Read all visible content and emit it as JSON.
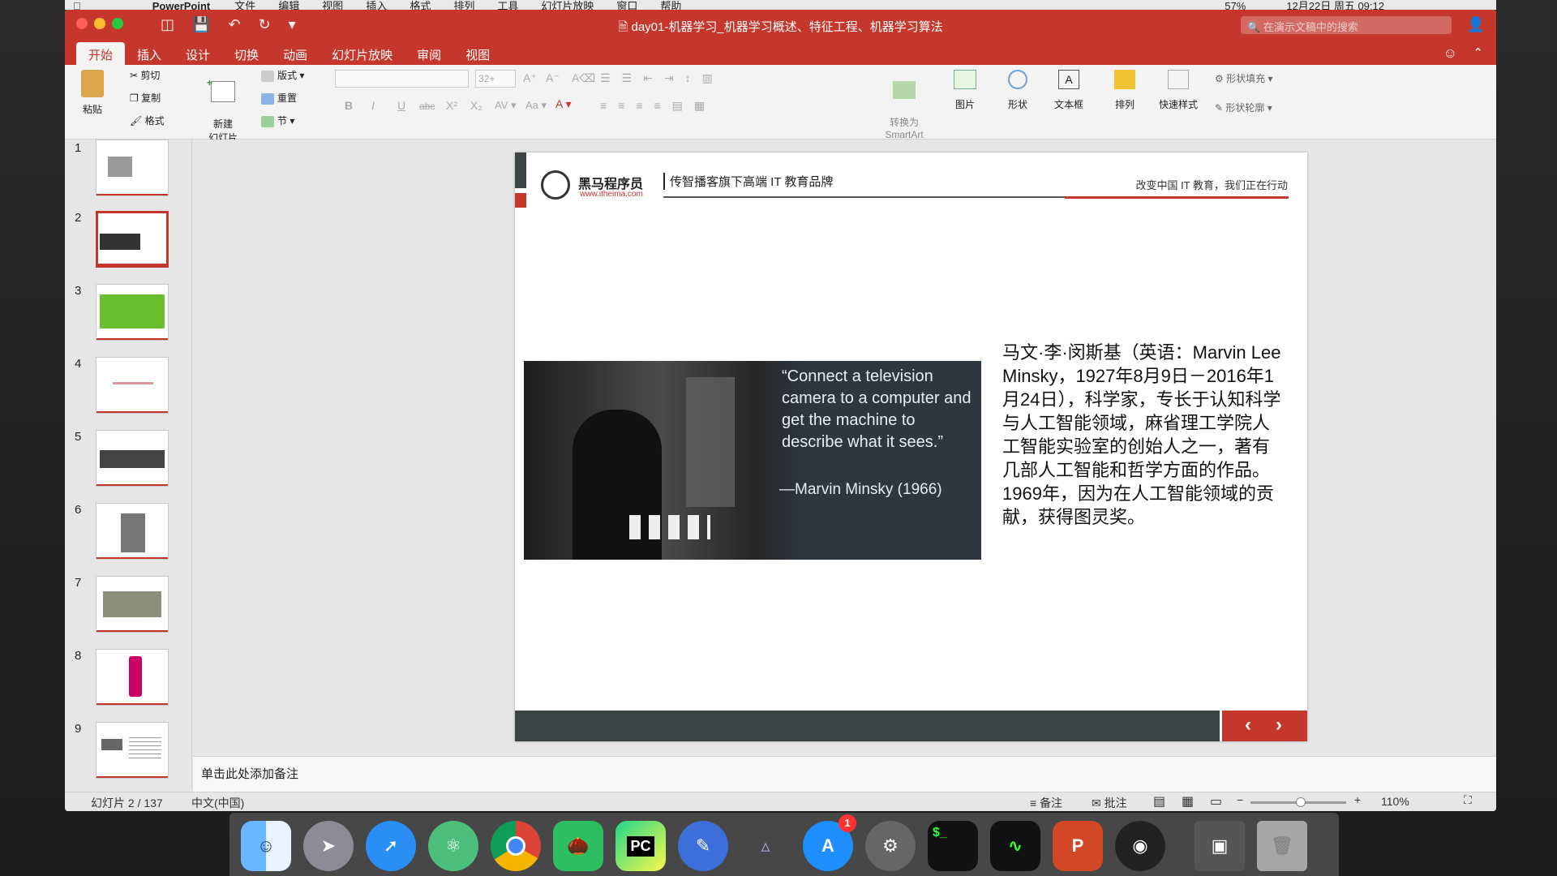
{
  "menubar": {
    "app": "PowerPoint",
    "items": [
      "文件",
      "编辑",
      "视图",
      "插入",
      "格式",
      "排列",
      "工具",
      "幻灯片放映",
      "窗口",
      "帮助"
    ],
    "battery": "57%",
    "datetime": "12月22日 周五 09:12"
  },
  "window": {
    "title": "day01-机器学习_机器学习概述、特征工程、机器学习算法",
    "search_placeholder": "在演示文稿中的搜索"
  },
  "tabs": [
    "开始",
    "插入",
    "设计",
    "切换",
    "动画",
    "幻灯片放映",
    "审阅",
    "视图"
  ],
  "ribbon": {
    "paste": "粘贴",
    "cut": "剪切",
    "copy": "复制",
    "format": "格式",
    "new_slide": "新建\n幻灯片",
    "layout": "版式",
    "reset": "重置",
    "section": "节",
    "font_size": "32+",
    "convert_smartart": "转换为\nSmartArt",
    "picture": "图片",
    "shape": "形状",
    "textbox": "文本框",
    "arrange": "排列",
    "quick_styles": "快速样式",
    "shape_fill": "形状填充",
    "shape_outline": "形状轮廓"
  },
  "thumbnails": [
    "1",
    "2",
    "3",
    "4",
    "5",
    "6",
    "7",
    "8",
    "9"
  ],
  "slide": {
    "logo_name": "黑马程序员",
    "logo_url": "www.itheima.com",
    "header_title": "传智播客旗下高端 IT 教育品牌",
    "slogan": "改变中国 IT 教育，我们正在行动",
    "quote": "“Connect a television camera to a computer and get the machine to describe what it sees.”",
    "quote_author": "—Marvin Minsky (1966)",
    "body": "马文·李·闵斯基（英语：Marvin Lee Minsky，1927年8月9日－2016年1月24日），科学家，专长于认知科学与人工智能领域，麻省理工学院人工智能实验室的创始人之一，著有几部人工智能和哲学方面的作品。1969年，因为在人工智能领域的贡献，获得图灵奖。"
  },
  "notes_placeholder": "单击此处添加备注",
  "status": {
    "slide_counter": "幻灯片 2 / 137",
    "language": "中文(中国)",
    "notes": "备注",
    "comments": "批注",
    "zoom": "110%"
  },
  "dock": {
    "badge": "1",
    "apps": [
      "finder-icon",
      "launchpad-icon",
      "safari-icon",
      "atom-icon",
      "chrome-icon",
      "evernote-icon",
      "pycharm-icon",
      "mindnode-icon",
      "keynote-icon",
      "appstore-icon",
      "system-preferences-icon",
      "terminal-icon",
      "activity-monitor-icon",
      "powerpoint-icon",
      "obs-icon",
      "screen-icon",
      "trash-icon"
    ]
  },
  "colors": {
    "accent": "#c5372c",
    "slide_footer": "#3d4446"
  }
}
